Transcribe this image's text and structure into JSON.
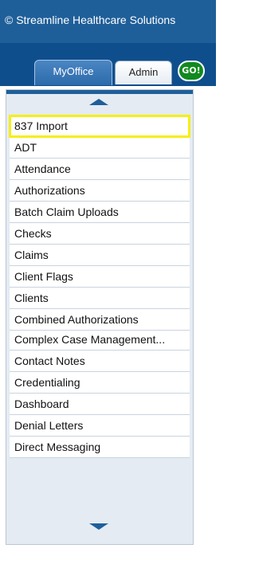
{
  "header": {
    "copyright": "© Streamline Healthcare Solutions"
  },
  "tabs": [
    {
      "label": "MyOffice",
      "active": true
    },
    {
      "label": "Admin",
      "active": false
    }
  ],
  "go_button": {
    "label": "GO!"
  },
  "menu": {
    "items": [
      {
        "label": "837 Import",
        "highlighted": true
      },
      {
        "label": "ADT"
      },
      {
        "label": "Attendance"
      },
      {
        "label": "Authorizations"
      },
      {
        "label": "Batch Claim Uploads"
      },
      {
        "label": "Checks"
      },
      {
        "label": "Claims"
      },
      {
        "label": "Client Flags"
      },
      {
        "label": "Clients"
      },
      {
        "label": "Combined Authorizations"
      },
      {
        "label": "Complex Case Management..."
      },
      {
        "label": "Contact Notes"
      },
      {
        "label": "Credentialing"
      },
      {
        "label": "Dashboard"
      },
      {
        "label": "Denial Letters"
      },
      {
        "label": "Direct Messaging"
      }
    ]
  },
  "icons": {
    "scroll_up": "triangle-up-icon",
    "scroll_down": "triangle-down-icon"
  },
  "colors": {
    "header_bg": "#1f5f99",
    "tabstrip_bg": "#0f4e8d",
    "highlight": "#f7ee14",
    "go_green": "#118a1f",
    "panel_bg": "#e4ebf2"
  }
}
